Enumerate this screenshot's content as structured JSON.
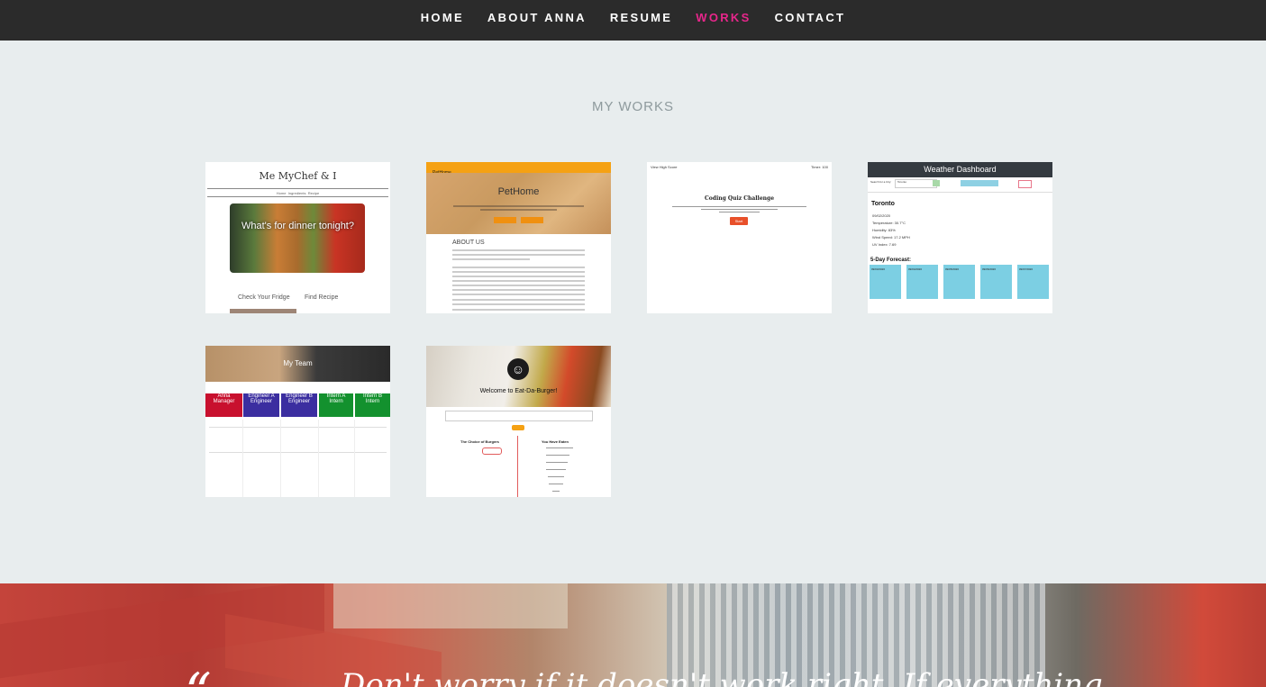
{
  "nav": {
    "items": [
      {
        "label": "HOME"
      },
      {
        "label": "ABOUT ANNA"
      },
      {
        "label": "RESUME"
      },
      {
        "label": "WORKS"
      },
      {
        "label": "CONTACT"
      }
    ],
    "active_color": "#e8268b"
  },
  "works": {
    "title": "MY WORKS",
    "projects": [
      {
        "name": "Me MyChef & I",
        "hero_text": "What's for dinner tonight?",
        "links": [
          "Home",
          "Ingredients",
          "Recipe"
        ],
        "sections": [
          "Check Your Fridge",
          "Find Recipe"
        ]
      },
      {
        "name": "PetHome",
        "brand": "PetHome",
        "about": "ABOUT US"
      },
      {
        "name": "Coding Quiz Challenge",
        "high_scores": "View High Score",
        "timer": "Timer: 100",
        "start": "Start"
      },
      {
        "name": "Weather Dashboard",
        "search_label": "Search for a City:",
        "search_value": "Toronto",
        "clear": "Clear",
        "city": "Toronto",
        "date": "09/02/2020",
        "temperature": "Temperature: 30.7°C",
        "humidity": "Humidity: 83%",
        "wind": "Wind Speed: 17.2 MPH",
        "uv": "UV Index: 7.69",
        "forecast_title": "5-Day Forecast:",
        "forecast_dates": [
          "09/03/2020",
          "09/04/2020",
          "09/05/2020",
          "09/06/2020",
          "09/07/2020"
        ]
      },
      {
        "name": "My Team",
        "members": [
          {
            "name": "Anna",
            "role": "Manager",
            "color": "#c8102e"
          },
          {
            "name": "Engineer A",
            "role": "Engineer",
            "color": "#3b2ea0"
          },
          {
            "name": "Engineer B",
            "role": "Engineer",
            "color": "#3b2ea0"
          },
          {
            "name": "Intern A",
            "role": "Intern",
            "color": "#13912e"
          },
          {
            "name": "Intern B",
            "role": "Intern",
            "color": "#13912e"
          }
        ]
      },
      {
        "name": "Eat-Da-Burger",
        "welcome": "Welcome to Eat-Da-Burger!",
        "choice": "The Choice of Burgers",
        "eaten": "You Have Eaten"
      }
    ]
  },
  "quote": {
    "mark": "“",
    "text": "Don't worry if it doesn't work right. If everything"
  }
}
